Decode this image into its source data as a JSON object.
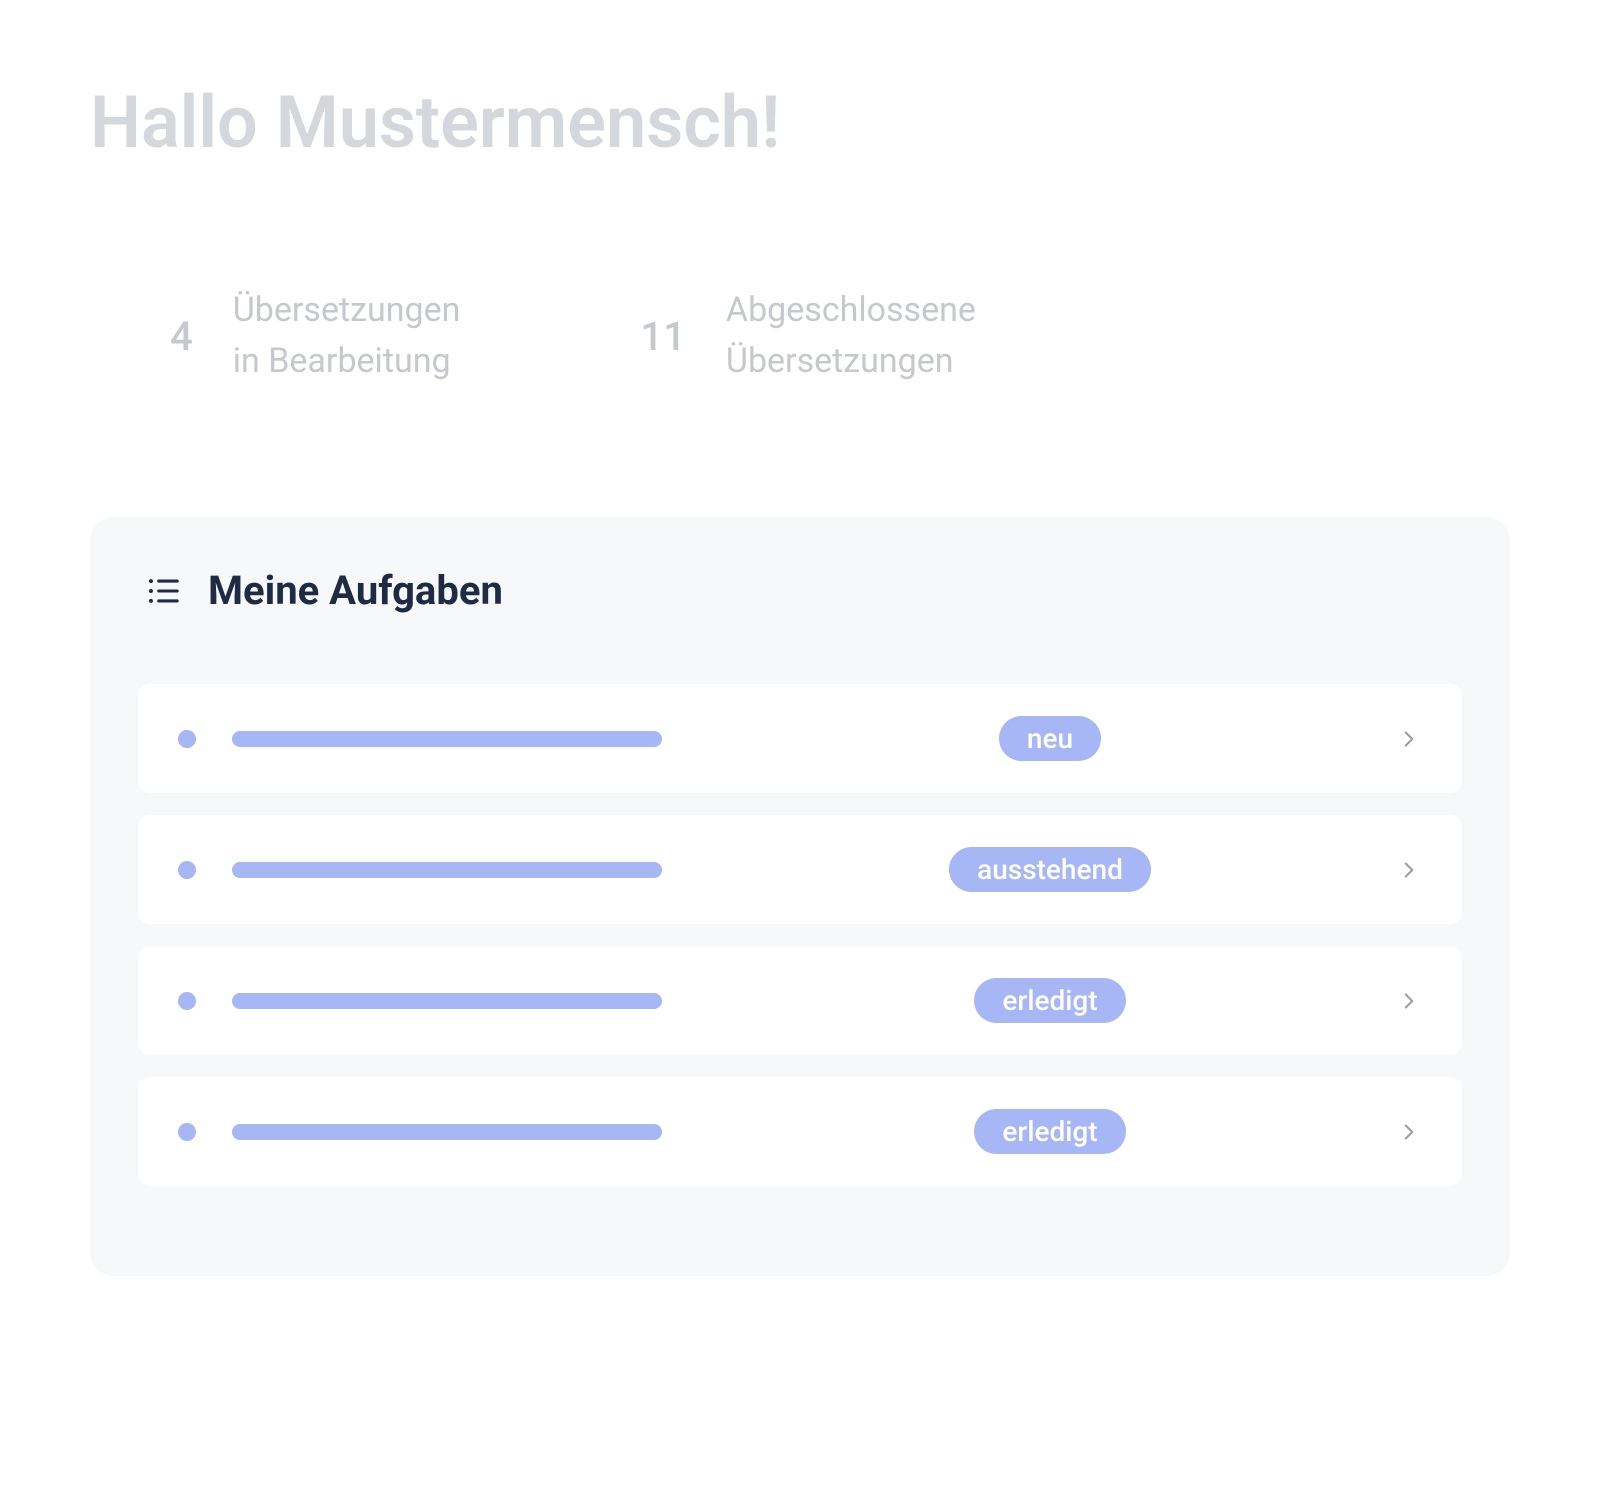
{
  "greeting": "Hallo Mustermensch!",
  "stats": {
    "in_progress": {
      "value": "4",
      "label_line1": "Übersetzungen",
      "label_line2": "in Bearbeitung"
    },
    "completed": {
      "value": "11",
      "label_line1": "Abgeschlossene",
      "label_line2": "Übersetzungen"
    }
  },
  "tasks": {
    "title": "Meine Aufgaben",
    "items": [
      {
        "status": "neu"
      },
      {
        "status": "ausstehend"
      },
      {
        "status": "erledigt"
      },
      {
        "status": "erledigt"
      }
    ]
  }
}
